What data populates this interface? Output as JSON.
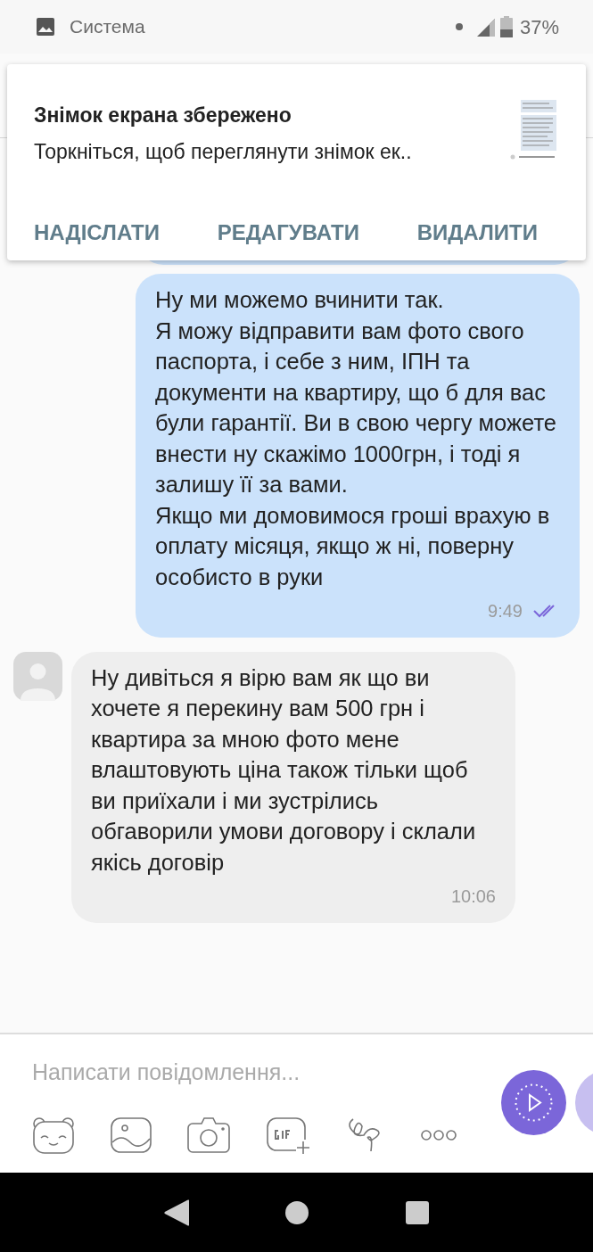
{
  "status_bar": {
    "app": "Система",
    "battery": "37%"
  },
  "notification": {
    "title": "Знімок екрана збережено",
    "text": "Торкніться, щоб переглянути знімок ек..",
    "actions": [
      "НАДІСЛАТИ",
      "РЕДАГУВАТИ",
      "ВИДАЛИТИ"
    ]
  },
  "messages": [
    {
      "kind": "sent",
      "text": "Ну ми можемо вчинити так.\nЯ можу відправити вам фото свого паспорта, і себе з ним, ІПН та документи на квартиру, що б для вас були гарантії. Ви в свою чергу можете внести ну скажімо 1000грн, і тоді я  залишу її за вами.\nЯкщо ми домовимося гроші врахую в оплату місяця, якщо ж ні, поверну особисто в руки",
      "time": "9:49",
      "read": true
    },
    {
      "kind": "received",
      "text": "Ну дивіться я вірю вам як що ви хочете я перекину вам 500 грн і квартира за мною фото мене влаштовують ціна також тільки щоб ви приїхали і ми зустрілись обгаворили умови договору і склали якісь договір",
      "time": "10:06"
    }
  ],
  "composer": {
    "placeholder": "Написати повідомлення..."
  }
}
